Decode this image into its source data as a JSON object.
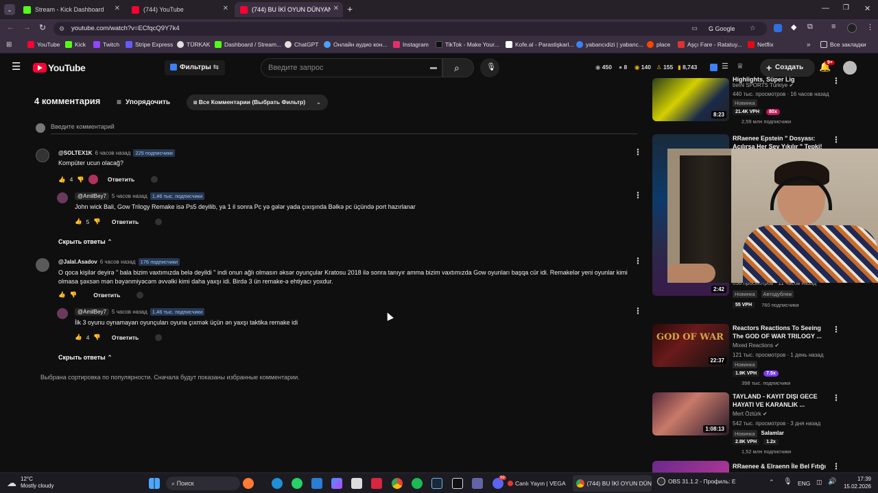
{
  "browser": {
    "tabs": [
      {
        "title": "Stream - Kick Dashboard",
        "color": "#53fc18"
      },
      {
        "title": "(744) YouTube",
        "color": "#ff0033"
      },
      {
        "title": "(744) BU İKİ OYUN DÜNYANI D",
        "color": "#ff0033"
      }
    ],
    "url": "youtube.com/watch?v=ECfqcQ9Y7k4",
    "google_label": "Google",
    "bookmarks": [
      {
        "label": "YouTube",
        "color": "#ff0033"
      },
      {
        "label": "Kick",
        "color": "#53fc18"
      },
      {
        "label": "Twitch",
        "color": "#9146ff"
      },
      {
        "label": "Stripe Express",
        "color": "#635bff"
      },
      {
        "label": "TÜRKAK",
        "color": "#e0e0e0"
      },
      {
        "label": "Dashboard / Stream...",
        "color": "#53fc18"
      },
      {
        "label": "ChatGPT",
        "color": "#e0e0e0"
      },
      {
        "label": "Онлайн аудио кон...",
        "color": "#4aa3ff"
      },
      {
        "label": "Instagram",
        "color": "#e1306c"
      },
      {
        "label": "TikTok - Make Your...",
        "color": "#111111"
      },
      {
        "label": "Kofe.al - Parastişkarl...",
        "color": "#ffffff"
      },
      {
        "label": "yabancıdizi | yabanc...",
        "color": "#3b82f6"
      },
      {
        "label": "place",
        "color": "#ff4500"
      },
      {
        "label": "Aşçı Fare - Ratatuy...",
        "color": "#d33"
      },
      {
        "label": "Netflix",
        "color": "#e50914"
      }
    ],
    "all_bookmarks": "Все закладки"
  },
  "youtube": {
    "logo_text": "YouTube",
    "filters_label": "Фильтры",
    "search_placeholder": "Введите запрос",
    "stats": [
      "450",
      "8",
      "140",
      "155",
      "8,743"
    ],
    "create_label": "Создать",
    "notif_count": "9+"
  },
  "comments": {
    "count_label": "4 комментария",
    "sort_label": "Упорядочить",
    "filter_label": "Все Комментарии (Выбрать Фильтр)",
    "input_placeholder": "Введите комментарий",
    "reply_label": "Ответить",
    "hide_replies_label": "Скрыть ответы",
    "footer_note": "Выбрана сортировка по популярности. Сначала будут показаны избранные комментарии.",
    "items": [
      {
        "author": "@SOLTEX1K",
        "time": "6 часов назад",
        "subs": "225 подписчики",
        "text": "Kompüter ucun olacağ?",
        "likes": "4"
      },
      {
        "author": "@AmilBey7",
        "time": "5 часов назад",
        "subs": "1,46 тыс. подписчики",
        "text": "John wick Bali, Gow Trilogy Remake isə Ps5 deyilib, ya 1 il sonra Pc yə gələr yada çıxışında Bəlkə pc üçündə port hazırlanar",
        "likes": "5"
      },
      {
        "author": "@Jalal.Asadov",
        "time": "6 часов назад",
        "subs": "176 подписчики",
        "text": "O qoca kişilər deyirə \" bala bizim vaxtımızda belə deyildi \" indi onun ağlı olmasın əksər oyunçular Kratosu 2018 ilə sonra tanıyır amma bizim vaxtımızda Gow oyunları başqa cür idi. Remakelər yeni oyunlar kimi olmasa şəxsən mən bəyənmiyəcəm əvvəlki kimi daha yaxşı idi. Birdə 3 ün remake-ə ehtiyacı yoxdur.",
        "likes": ""
      },
      {
        "author": "@AmilBey7",
        "time": "5 часов назад",
        "subs": "1,46 тыс. подписчики",
        "text": "İlk 3 oyunu oynamayan oyunçuları oyuna çıxmək üçün ən yaxşı taktika remake idi",
        "likes": "4"
      }
    ]
  },
  "sidebar": {
    "videos": [
      {
        "title": "Highlights, Süper Lig",
        "channel": "beIN SPORTS Türkiye",
        "views": "440 тыс. просмотров · 16 часов назад",
        "badge": "Новинка",
        "vph": "21.4K VPH",
        "mult": "80x",
        "subs": "2,59 млн подписчики",
        "duration": "8:23"
      },
      {
        "title": "RRaenee Epstein \" Dosyası: Açılırsa Her Şey Yıkılır \" Tepki!",
        "channel": "",
        "views": "658 просмотров · 11 часов назад",
        "badge": "Новинка",
        "auto": "Автодубляж",
        "vph": "55 VPH",
        "mult": "",
        "subs": "760 подписчики",
        "duration": "2:42"
      },
      {
        "title": "Reactors Reactions To Seeing The GOD OF WAR TRILOGY ...",
        "channel": "Mixed Reactions",
        "views": "121 тыс. просмотров · 1 день назад",
        "badge": "Новинка",
        "vph": "1.9K VPH",
        "mult": "7.5x",
        "subs": "398 тыс. подписчики",
        "duration": "22:37"
      },
      {
        "title": "TAYLAND - KAYIT DIŞI GECE HAYATI VE KARANLIK ...",
        "channel": "Mert Öztürk",
        "views": "542 тыс. просмотров · 3 дня назад",
        "badge": "Новинка",
        "vph": "2.8K VPH",
        "mult": "1.2x",
        "subs": "1,52 млн подписчики",
        "duration": "1:08:13"
      },
      {
        "title": "RRaenee & Elraenn İle Bel Fıtığı",
        "channel": "",
        "views": "",
        "badge": "",
        "vph": "",
        "mult": "",
        "subs": "",
        "duration": ""
      }
    ],
    "overlay_label": "Salamlar"
  },
  "taskbar": {
    "weather_temp": "12°C",
    "weather_desc": "Mostly cloudy",
    "search_label": "Поиск",
    "app1": "Canlı Yayın | VEGA",
    "app2": "(744) BU İKİ OYUN DÜN",
    "app3": "OBS 31.1.2 - Профиль: E",
    "lang": "ENG",
    "time": "17:39",
    "date": "15.02.2026",
    "discord_badge": "99"
  }
}
